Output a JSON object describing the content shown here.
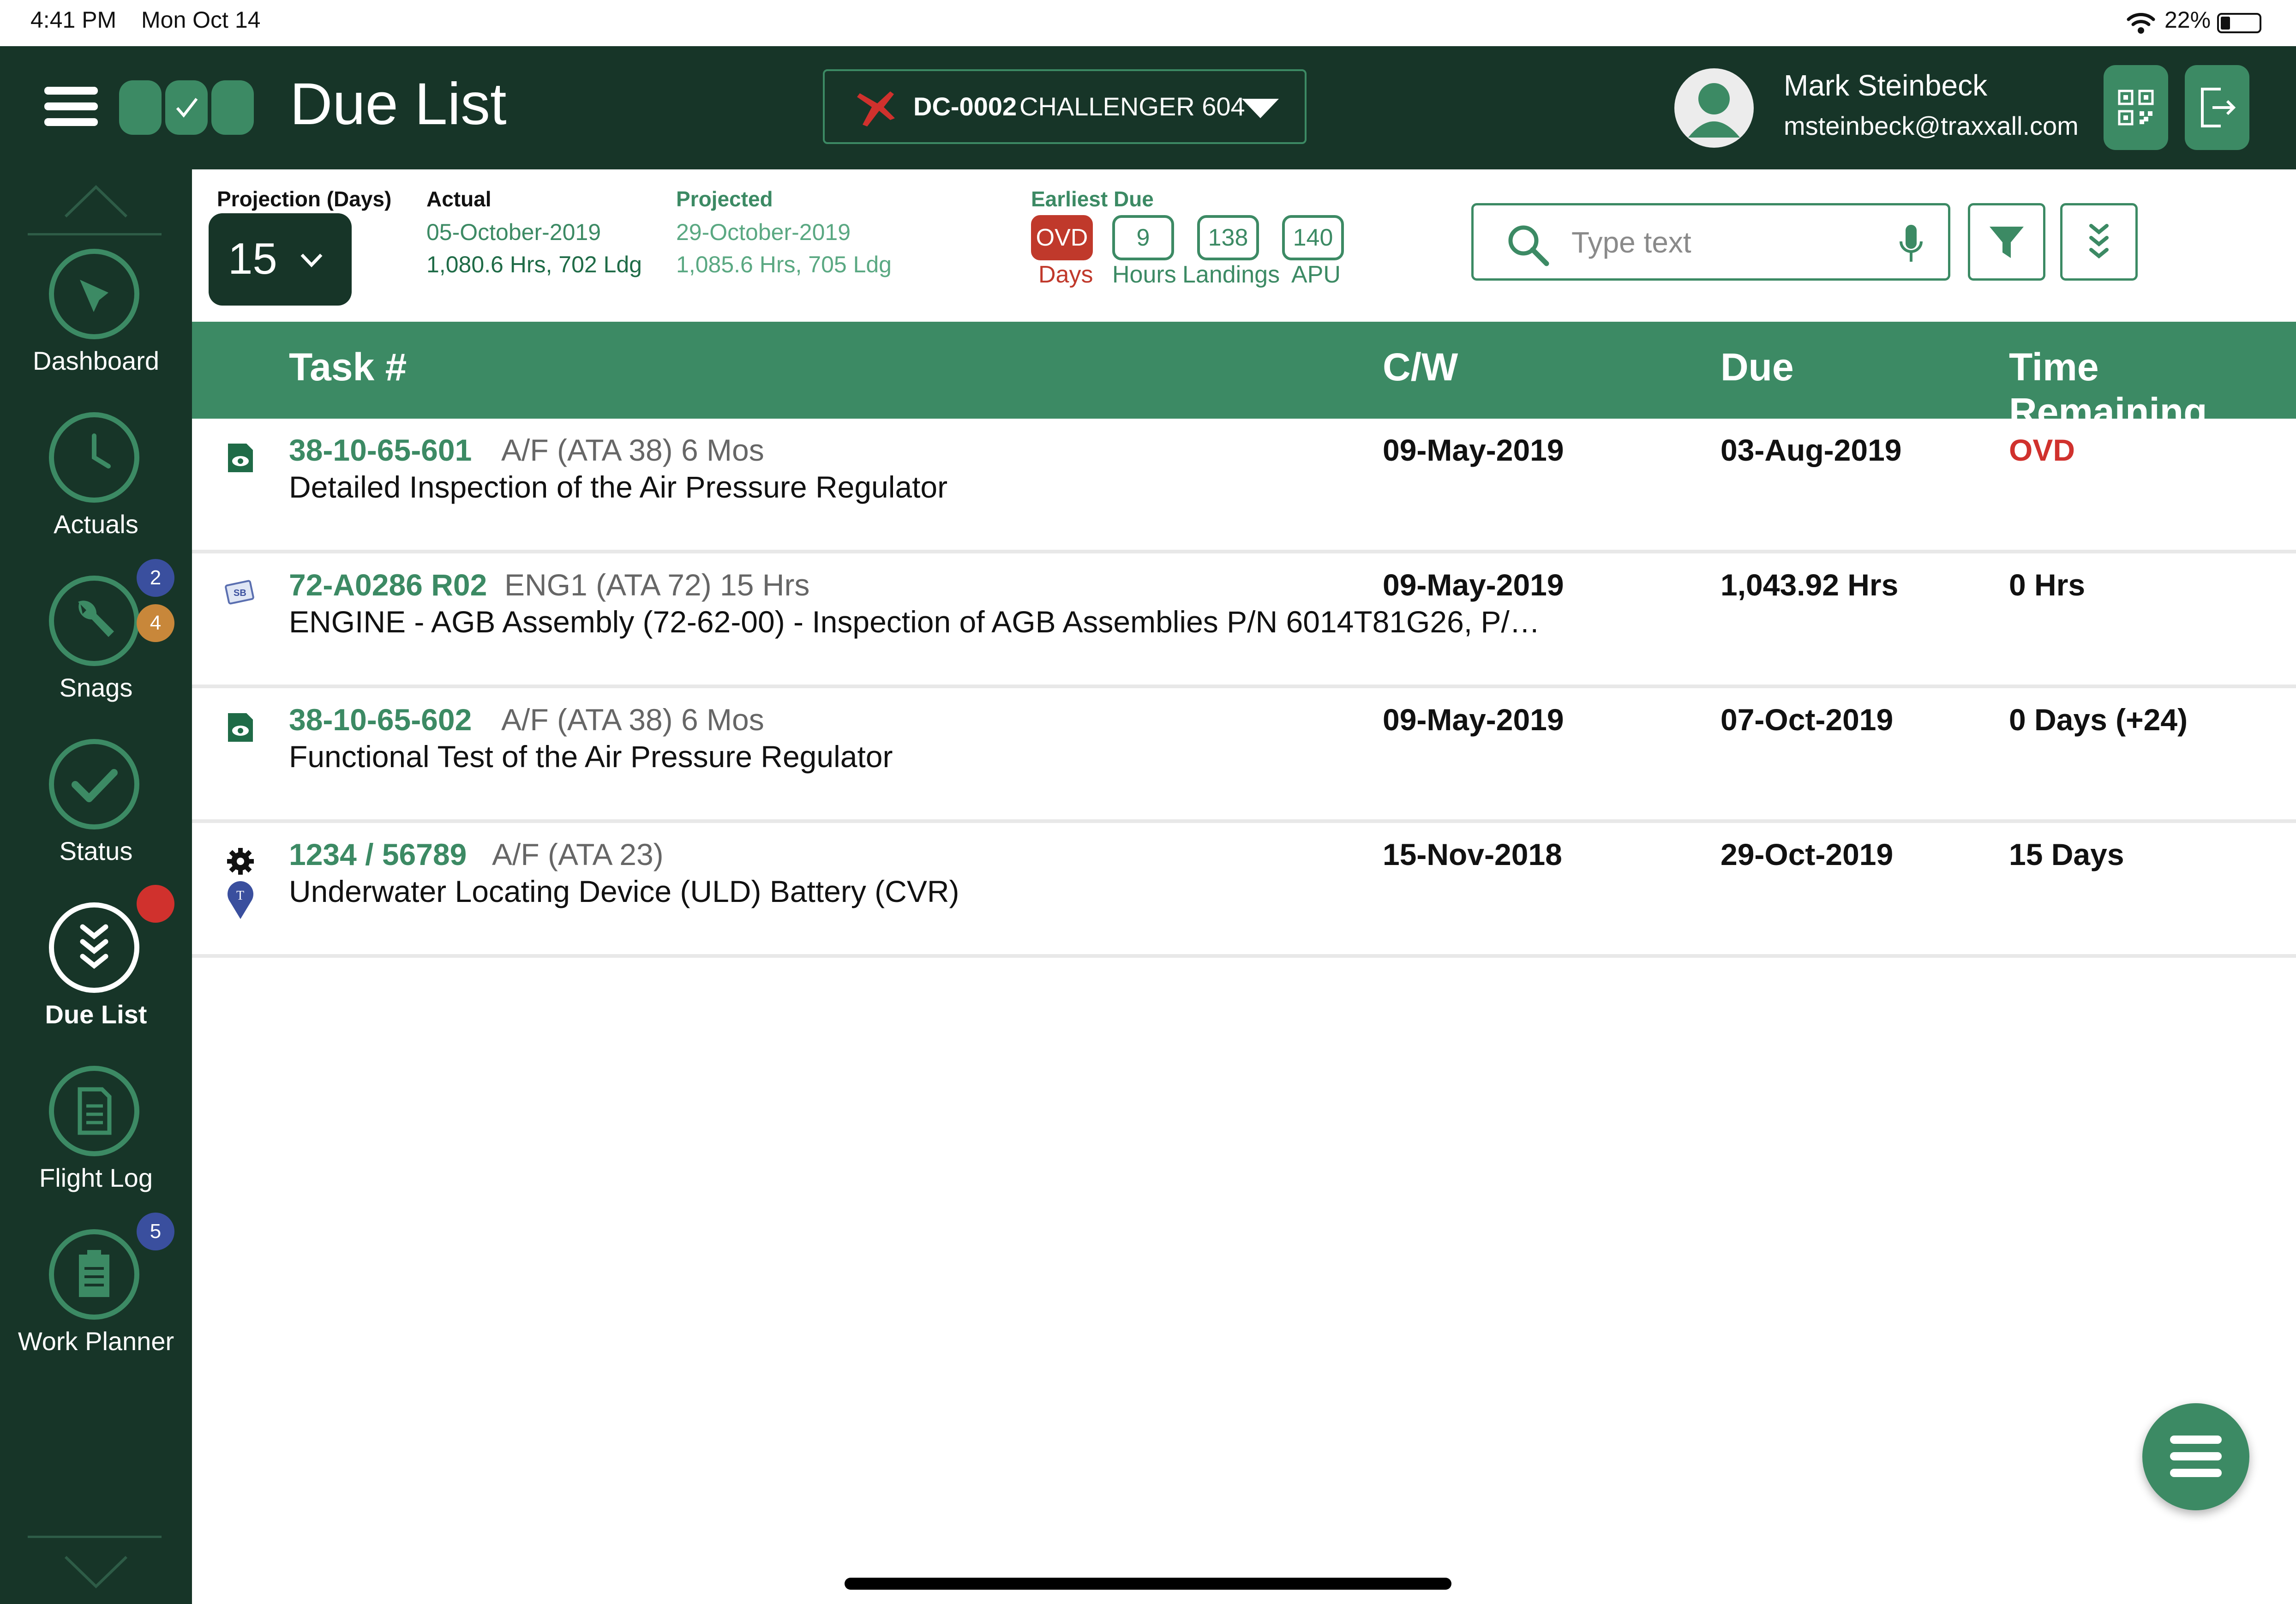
{
  "status_bar": {
    "time": "4:41 PM",
    "date": "Mon Oct 14",
    "battery": "22%"
  },
  "header": {
    "title": "Due List",
    "aircraft": {
      "registration": "DC-0002",
      "model": "CHALLENGER 604"
    },
    "user": {
      "name": "Mark Steinbeck",
      "email": "msteinbeck@traxxall.com"
    }
  },
  "sidebar": {
    "items": [
      {
        "label": "Dashboard",
        "icon": "dashboard-icon"
      },
      {
        "label": "Actuals",
        "icon": "clock-icon"
      },
      {
        "label": "Snags",
        "icon": "wrench-icon",
        "badges": [
          "2",
          "4"
        ]
      },
      {
        "label": "Status",
        "icon": "checkmark-icon"
      },
      {
        "label": "Due List",
        "icon": "chevrons-down-icon",
        "active": true
      },
      {
        "label": "Flight Log",
        "icon": "document-icon"
      },
      {
        "label": "Work Planner",
        "icon": "clipboard-icon",
        "badges": [
          "5"
        ]
      }
    ]
  },
  "toolbar": {
    "projection_label": "Projection (Days)",
    "projection_value": "15",
    "actual": {
      "title": "Actual",
      "date": "05-October-2019",
      "values": "1,080.6 Hrs, 702 Ldg"
    },
    "projected": {
      "title": "Projected",
      "date": "29-October-2019",
      "values": "1,085.6 Hrs, 705 Ldg"
    },
    "earliest_due": {
      "title": "Earliest Due",
      "items": [
        {
          "value": "OVD",
          "label": "Days"
        },
        {
          "value": "9",
          "label": "Hours"
        },
        {
          "value": "138",
          "label": "Landings"
        },
        {
          "value": "140",
          "label": "APU"
        }
      ]
    },
    "search_placeholder": "Type text"
  },
  "table": {
    "columns": [
      "Task #",
      "C/W",
      "Due",
      "Time Remaining"
    ],
    "rows": [
      {
        "task": "38-10-65-601",
        "meta": "A/F (ATA 38) 6 Mos",
        "description": "Detailed Inspection of the Air Pressure Regulator",
        "cw": "09-May-2019",
        "due": "03-Aug-2019",
        "remaining": "OVD",
        "icon": "inspection-doc-icon"
      },
      {
        "task": "72-A0286 R02",
        "meta": "ENG1 (ATA 72) 15 Hrs",
        "description": "ENGINE - AGB Assembly (72-62-00) - Inspection of AGB Assemblies P/N 6014T81G26, P/…",
        "cw": "09-May-2019",
        "due": "1,043.92 Hrs",
        "remaining": "0 Hrs",
        "icon": "service-bulletin-icon"
      },
      {
        "task": "38-10-65-602",
        "meta": "A/F (ATA 38) 6 Mos",
        "description": "Functional Test of the Air Pressure Regulator",
        "cw": "09-May-2019",
        "due": "07-Oct-2019",
        "remaining": "0 Days (+24)",
        "icon": "inspection-doc-icon"
      },
      {
        "task": "1234 / 56789",
        "meta": "A/F (ATA 23)",
        "description": "Underwater Locating Device (ULD) Battery (CVR)",
        "cw": "15-Nov-2018",
        "due": "29-Oct-2019",
        "remaining": "15 Days",
        "icon": "gear-icon",
        "pin_letter": "T"
      }
    ]
  },
  "colors": {
    "header_bg": "#173528",
    "accent": "#3c8a64",
    "overdue": "#d0312d",
    "badge_blue": "#3a4f9e",
    "badge_orange": "#c8873a"
  }
}
